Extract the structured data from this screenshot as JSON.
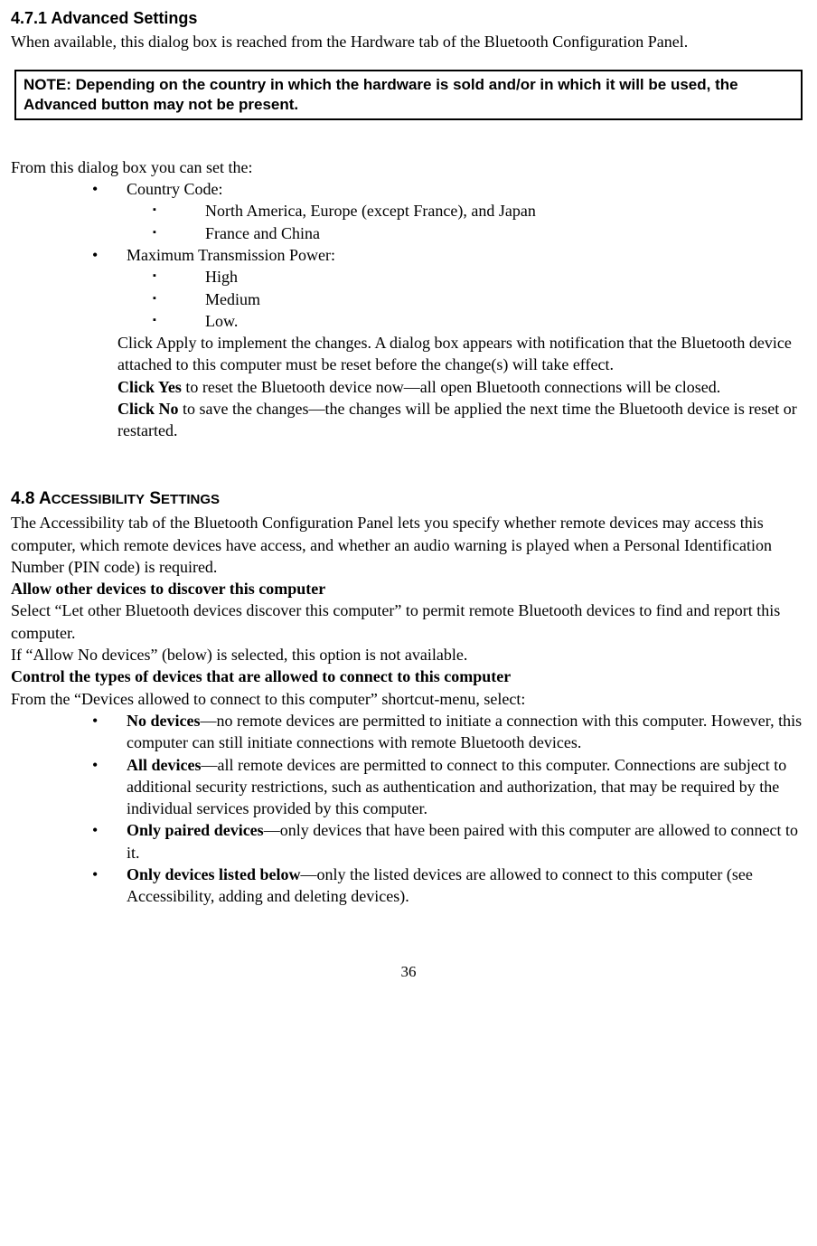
{
  "s471": {
    "heading": "4.7.1 Advanced Settings",
    "intro": "When available, this dialog box is reached from the Hardware tab of the Bluetooth Configuration Panel.",
    "note": "NOTE: Depending on the country in which the hardware is sold and/or in which it will be used, the Advanced button may not be present.",
    "lead": "From this dialog box you can set the:",
    "item1": "  Country Code:",
    "item1a": "North America, Europe (except France), and Japan",
    "item1b": "France and China",
    "item2": "Maximum Transmission Power:",
    "item2a": "High",
    "item2b": "Medium",
    "item2c": "Low.",
    "apply": "Click Apply to implement the changes. A dialog box appears with notification that the Bluetooth device attached to this computer must be reset before the change(s) will take effect.",
    "yes_bold": "Click Yes",
    "yes_rest": " to reset the Bluetooth device now—all open Bluetooth connections will be closed.",
    "no_bold": "Click No",
    "no_rest": " to save the changes—the changes will be applied the next time the Bluetooth device is reset or restarted."
  },
  "s48": {
    "heading_prefix": "4.8 A",
    "heading_word1_rest": "CCESSIBILITY",
    "heading_space": " S",
    "heading_word2_rest": "ETTINGS",
    "intro": "The Accessibility tab of the Bluetooth Configuration Panel lets you specify whether remote devices may access this computer, which remote devices have access, and whether an audio warning is played when a Personal Identification Number (PIN code) is required.",
    "h_allow": "Allow other devices to discover this computer",
    "allow1": "Select “Let other Bluetooth devices discover this computer” to permit remote Bluetooth devices to find and report this computer.",
    "allow2": "If “Allow No devices” (below) is selected, this option is not available.",
    "h_control": "Control the types of devices that are allowed to connect to this computer",
    "control_lead": "From the “Devices allowed to connect to this computer” shortcut-menu, select:",
    "b1_bold": "No devices",
    "b1_rest": "—no remote devices are permitted to initiate a connection with this computer. However, this computer can still initiate connections with remote Bluetooth devices.",
    "b2_bold": "All devices",
    "b2_rest": "—all remote devices are permitted to connect to this computer. Connections are subject to additional security restrictions, such as authentication and authorization, that may be required by the individual services provided by this computer.",
    "b3_bold": "Only paired devices",
    "b3_rest": "—only devices that have been paired with this computer are allowed to connect to it.",
    "b4_bold": "Only devices listed below",
    "b4_rest": "—only the listed devices are allowed to connect to this computer (see Accessibility, adding and deleting devices)."
  },
  "page_number": "36"
}
